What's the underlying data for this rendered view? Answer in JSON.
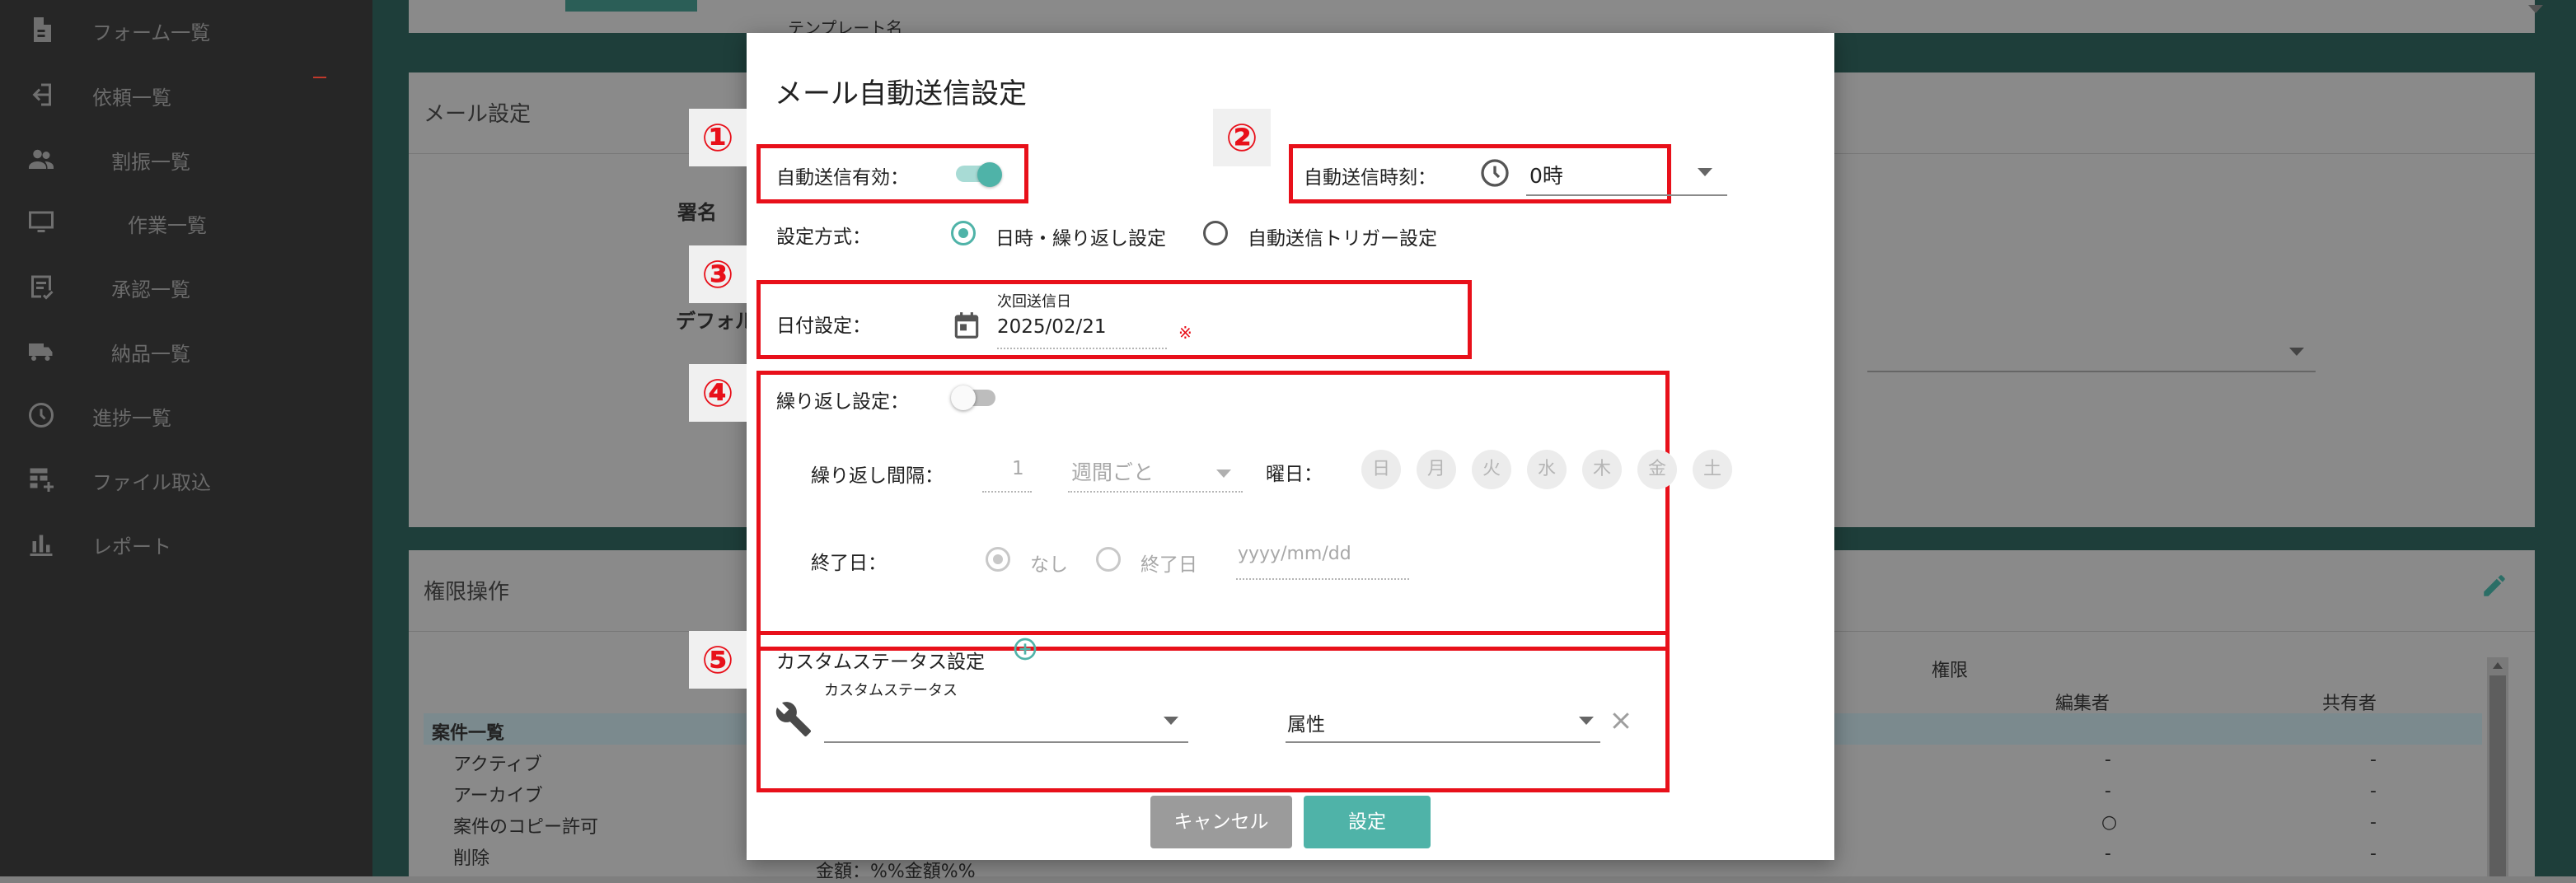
{
  "sidebar": {
    "items": [
      {
        "label": "フォーム一覧",
        "icon": "document-icon"
      },
      {
        "label": "依頼一覧",
        "icon": "login-icon"
      },
      {
        "label": "割振一覧",
        "icon": "people-icon"
      },
      {
        "label": "作業一覧",
        "icon": "monitor-icon"
      },
      {
        "label": "承認一覧",
        "icon": "approval-icon"
      },
      {
        "label": "納品一覧",
        "icon": "truck-icon"
      },
      {
        "label": "進捗一覧",
        "icon": "history-icon"
      },
      {
        "label": "ファイル取込",
        "icon": "table-add-icon"
      },
      {
        "label": "レポート",
        "icon": "bar-chart-icon"
      }
    ]
  },
  "background": {
    "template_name_label": "テンプレート名",
    "mail_settings_title": "メール設定",
    "signature_label": "署名",
    "default_label": "デフォル",
    "permissions_title": "権限操作",
    "table": {
      "group_header": "権限",
      "columns": [
        "編集者",
        "共有者"
      ],
      "section": "案件一覧",
      "rows": [
        {
          "label": "アクティブ",
          "editor": "-",
          "sharer": "-"
        },
        {
          "label": "アーカイブ",
          "editor": "-",
          "sharer": "-"
        },
        {
          "label": "案件のコピー許可",
          "editor": "○",
          "sharer": "-"
        },
        {
          "label": "削除",
          "editor": "-",
          "sharer": "-"
        }
      ],
      "footer_text": "金額：%%金額%%"
    }
  },
  "modal": {
    "title": "メール自動送信設定",
    "badges": [
      "①",
      "②",
      "③",
      "④",
      "⑤"
    ],
    "auto_send_enabled_label": "自動送信有効：",
    "auto_send_enabled": true,
    "auto_send_time_label": "自動送信時刻：",
    "auto_send_time_value": "0時",
    "method_label": "設定方式：",
    "method_options": [
      "日時・繰り返し設定",
      "自動送信トリガー設定"
    ],
    "method_selected": 0,
    "date_setting_label": "日付設定：",
    "next_send_date_label": "次回送信日",
    "next_send_date_value": "2025/02/21",
    "required_mark": "※",
    "repeat_label": "繰り返し設定：",
    "repeat_enabled": false,
    "repeat_interval_label": "繰り返し間隔：",
    "repeat_interval_value": "1",
    "repeat_unit": "週間ごと",
    "weekday_label": "曜日：",
    "weekdays": [
      "日",
      "月",
      "火",
      "水",
      "木",
      "金",
      "土"
    ],
    "end_date_label": "終了日：",
    "end_date_options": [
      "なし",
      "終了日"
    ],
    "end_date_selected": 0,
    "end_date_placeholder": "yyyy/mm/dd",
    "custom_status_title": "カスタムステータス設定",
    "custom_status_field_label": "カスタムステータス",
    "attribute_placeholder": "属性",
    "cancel_label": "キャンセル",
    "submit_label": "設定",
    "accent_color": "#4fb3a8",
    "highlight_color": "#e8101a"
  }
}
